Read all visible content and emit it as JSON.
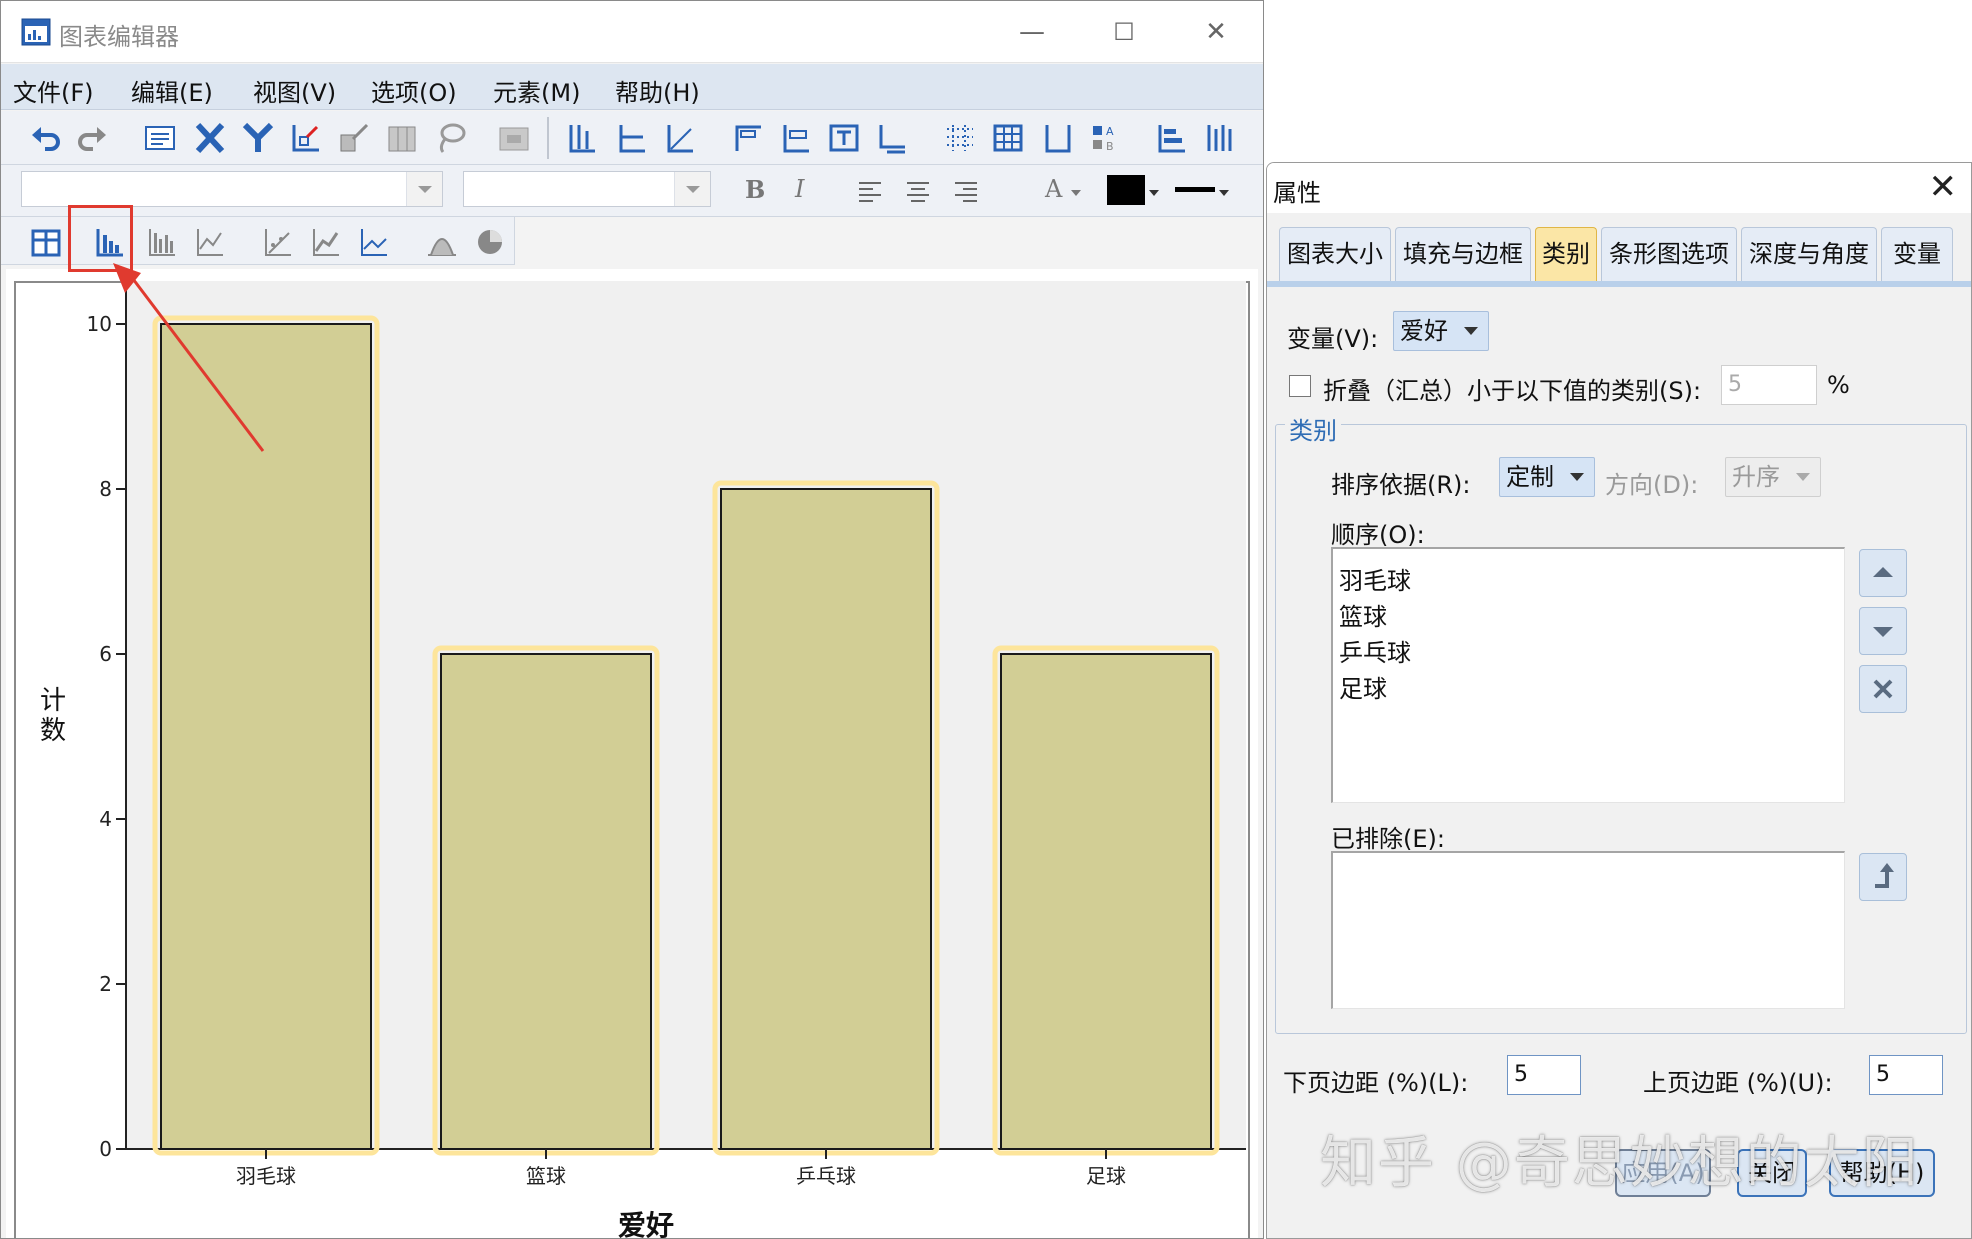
{
  "window": {
    "title": "图表编辑器",
    "minimize_glyph": "—",
    "maximize_glyph": "☐",
    "close_glyph": "✕"
  },
  "menu": [
    "文件(F)",
    "编辑(E)",
    "视图(V)",
    "选项(O)",
    "元素(M)",
    "帮助(H)"
  ],
  "toolbar": {
    "bold_label": "B",
    "italic_label": "I",
    "font_color_label": "A",
    "icons": [
      "undo-icon",
      "redo-icon",
      "properties-icon",
      "x-axis-icon",
      "y-axis-icon",
      "scale-icon",
      "reference-line-icon",
      "grid-icon",
      "lasso-icon",
      "data-editor-icon",
      "chart-type-bar-icon",
      "transpose-icon",
      "legend-icon",
      "bar-chart-icon",
      "line-chart-icon",
      "pie-chart-icon"
    ]
  },
  "chart_data": {
    "type": "bar",
    "categories": [
      "羽毛球",
      "篮球",
      "乒乓球",
      "足球"
    ],
    "values": [
      10,
      6,
      8,
      6
    ],
    "title": "",
    "xlabel": "爱好",
    "ylabel": "计数",
    "ylim": [
      0,
      10
    ],
    "yticks": [
      0,
      2,
      4,
      6,
      8,
      10
    ],
    "bar_fill": "#d2ce95",
    "bar_stroke": "#1a1a1a",
    "selection_color": "#fde59b",
    "grid": false
  },
  "annotation": {
    "highlight_color": "#e03a2f"
  },
  "properties": {
    "title": "属性",
    "close_glyph": "✕",
    "tabs": [
      "图表大小",
      "填充与边框",
      "类别",
      "条形图选项",
      "深度与角度",
      "变量"
    ],
    "active_tab": "类别",
    "variable_label": "变量(V):",
    "variable_value": "爱好",
    "collapse_label": "折叠（汇总）小于以下值的类别(S):",
    "collapse_value": "5",
    "percent_sign": "%",
    "group_title": "类别",
    "sort_label": "排序依据(R):",
    "sort_value": "定制",
    "direction_label": "方向(D):",
    "direction_value": "升序",
    "order_label": "顺序(O):",
    "order_items": [
      "羽毛球",
      "篮球",
      "乒乓球",
      "足球"
    ],
    "excluded_label": "已排除(E):",
    "lower_margin_label": "下页边距 (%)(L):",
    "lower_margin_value": "5",
    "upper_margin_label": "上页边距 (%)(U):",
    "upper_margin_value": "5",
    "buttons": {
      "apply": "应用(A)",
      "close": "关闭",
      "help": "帮助(H)"
    }
  },
  "watermark": "知乎 @奇思妙想的太阳"
}
